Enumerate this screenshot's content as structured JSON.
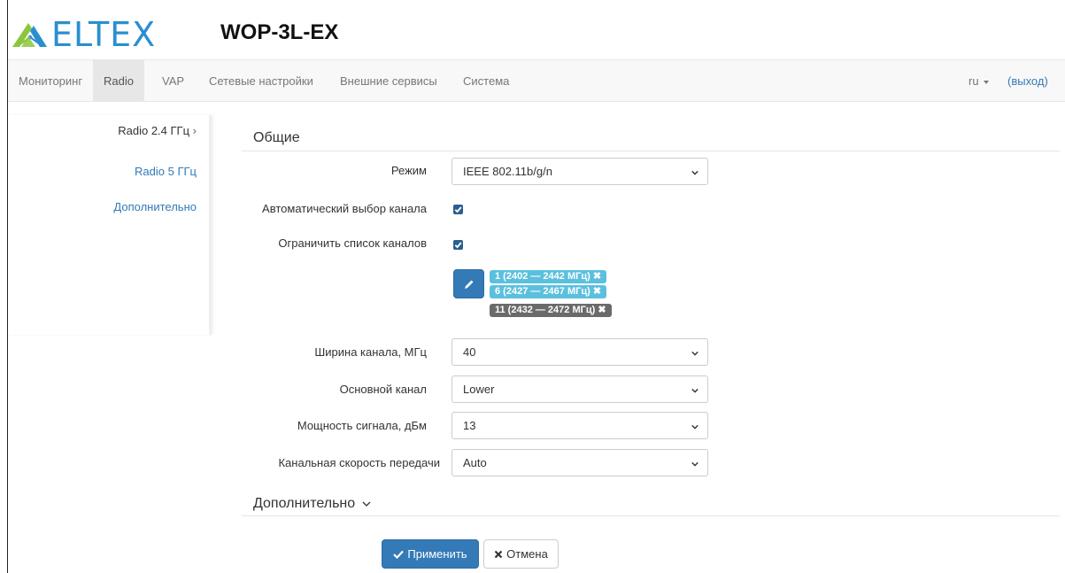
{
  "header": {
    "logo_text": "ELTEX",
    "device": "WOP-3L-EX"
  },
  "nav": {
    "items": [
      {
        "label": "Мониторинг"
      },
      {
        "label": "Radio"
      },
      {
        "label": "VAP"
      },
      {
        "label": "Сетевые настройки"
      },
      {
        "label": "Внешние сервисы"
      },
      {
        "label": "Система"
      }
    ],
    "active": "Radio",
    "language": "ru",
    "logout": "(выход)"
  },
  "sidemenu": {
    "items": [
      {
        "label": "Radio 2.4 ГГц",
        "arrow": "›"
      },
      {
        "label": "Radio 5 ГГц"
      },
      {
        "label": "Дополнительно"
      }
    ]
  },
  "general": {
    "title": "Общие",
    "mode": {
      "label": "Режим",
      "value": "IEEE 802.11b/g/n"
    },
    "auto_channel": {
      "label": "Автоматический выбор канала",
      "checked": true
    },
    "limit_channels": {
      "label": "Ограничить список каналов",
      "checked": true
    },
    "channels": [
      {
        "text": "1 (2402 — 2442 МГц)",
        "x": "✖"
      },
      {
        "text": "6 (2427 — 2467 МГц)",
        "x": "✖"
      },
      {
        "text": "11 (2432 — 2472 МГц)",
        "x": "✖"
      }
    ],
    "width": {
      "label": "Ширина канала, МГц",
      "value": "40"
    },
    "primary": {
      "label": "Основной канал",
      "value": "Lower"
    },
    "power": {
      "label": "Мощность сигнала, дБм",
      "value": "13"
    },
    "rate": {
      "label": "Канальная скорость передачи",
      "value": "Auto"
    }
  },
  "advanced": {
    "title": "Дополнительно"
  },
  "actions": {
    "apply": "Применить",
    "cancel": "Отмена"
  },
  "colors": {
    "accent": "#337ab7",
    "logo_blue": "#2a8fd0",
    "logo_green": "#8cc63f",
    "tag_info": "#5bc0de",
    "tag_dark": "#6a6a6a"
  }
}
